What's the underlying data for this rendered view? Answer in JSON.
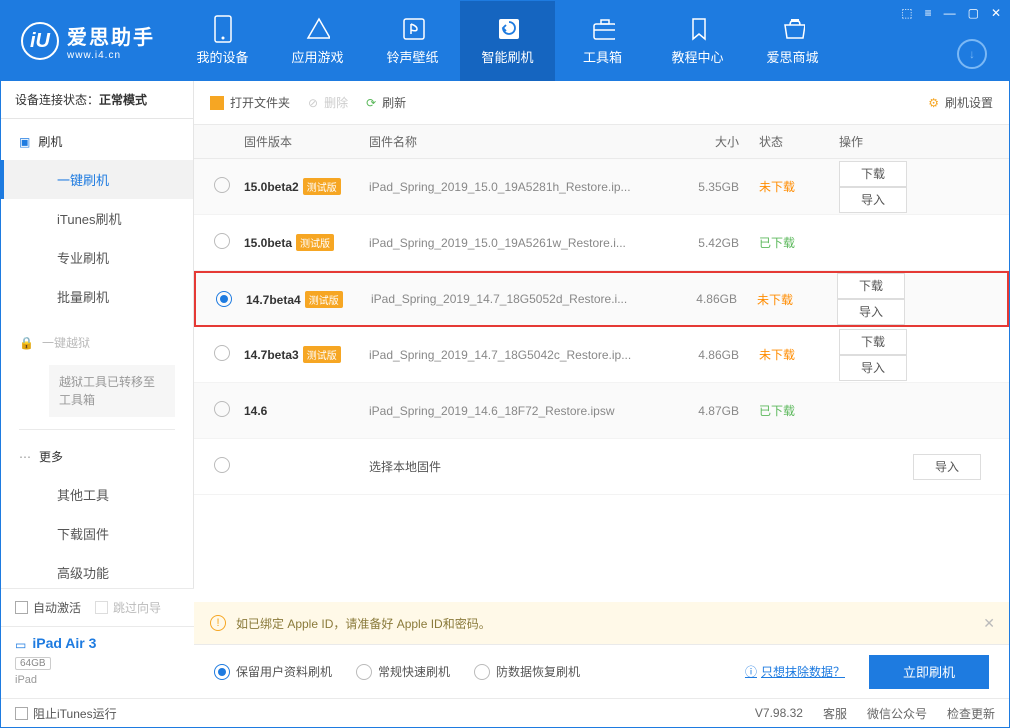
{
  "logo": {
    "title": "爱思助手",
    "sub": "www.i4.cn"
  },
  "nav": [
    {
      "label": "我的设备"
    },
    {
      "label": "应用游戏"
    },
    {
      "label": "铃声壁纸"
    },
    {
      "label": "智能刷机"
    },
    {
      "label": "工具箱"
    },
    {
      "label": "教程中心"
    },
    {
      "label": "爱思商城"
    }
  ],
  "conn": {
    "prefix": "设备连接状态：",
    "value": "正常模式"
  },
  "sidebar": {
    "flash": {
      "label": "刷机",
      "items": [
        "一键刷机",
        "iTunes刷机",
        "专业刷机",
        "批量刷机"
      ]
    },
    "jailbreak": {
      "label": "一键越狱",
      "note": "越狱工具已转移至工具箱"
    },
    "more": {
      "label": "更多",
      "items": [
        "其他工具",
        "下载固件",
        "高级功能"
      ]
    }
  },
  "checks": {
    "autoActivate": "自动激活",
    "skipGuide": "跳过向导"
  },
  "device": {
    "name": "iPad Air 3",
    "capacity": "64GB",
    "type": "iPad"
  },
  "toolbar": {
    "open": "打开文件夹",
    "delete": "删除",
    "refresh": "刷新",
    "settings": "刷机设置"
  },
  "table": {
    "headers": {
      "ver": "固件版本",
      "name": "固件名称",
      "size": "大小",
      "status": "状态",
      "ops": "操作"
    }
  },
  "rows": [
    {
      "ver": "15.0beta2",
      "beta": true,
      "name": "iPad_Spring_2019_15.0_19A5281h_Restore.ip...",
      "size": "5.35GB",
      "status": "未下载",
      "statusClass": "und",
      "checked": false,
      "ops": [
        "下载",
        "导入"
      ]
    },
    {
      "ver": "15.0beta",
      "beta": true,
      "name": "iPad_Spring_2019_15.0_19A5261w_Restore.i...",
      "size": "5.42GB",
      "status": "已下载",
      "statusClass": "dl",
      "checked": false,
      "ops": []
    },
    {
      "ver": "14.7beta4",
      "beta": true,
      "name": "iPad_Spring_2019_14.7_18G5052d_Restore.i...",
      "size": "4.86GB",
      "status": "未下载",
      "statusClass": "und",
      "checked": true,
      "highlight": true,
      "ops": [
        "下载",
        "导入"
      ]
    },
    {
      "ver": "14.7beta3",
      "beta": true,
      "name": "iPad_Spring_2019_14.7_18G5042c_Restore.ip...",
      "size": "4.86GB",
      "status": "未下载",
      "statusClass": "und",
      "checked": false,
      "ops": [
        "下载",
        "导入"
      ]
    },
    {
      "ver": "14.6",
      "beta": false,
      "name": "iPad_Spring_2019_14.6_18F72_Restore.ipsw",
      "size": "4.87GB",
      "status": "已下载",
      "statusClass": "dl",
      "checked": false,
      "ops": []
    },
    {
      "ver": "",
      "beta": false,
      "name": "选择本地固件",
      "size": "",
      "status": "",
      "statusClass": "",
      "checked": false,
      "local": true,
      "ops": [
        "导入"
      ]
    }
  ],
  "betaLabel": "测试版",
  "notice": "如已绑定 Apple ID，请准备好 Apple ID和密码。",
  "options": {
    "keep": "保留用户资料刷机",
    "normal": "常规快速刷机",
    "antiloss": "防数据恢复刷机",
    "eraseLink": "只想抹除数据？",
    "flashNow": "立即刷机"
  },
  "footer": {
    "blockItunes": "阻止iTunes运行",
    "version": "V7.98.32",
    "service": "客服",
    "wechat": "微信公众号",
    "update": "检查更新"
  }
}
